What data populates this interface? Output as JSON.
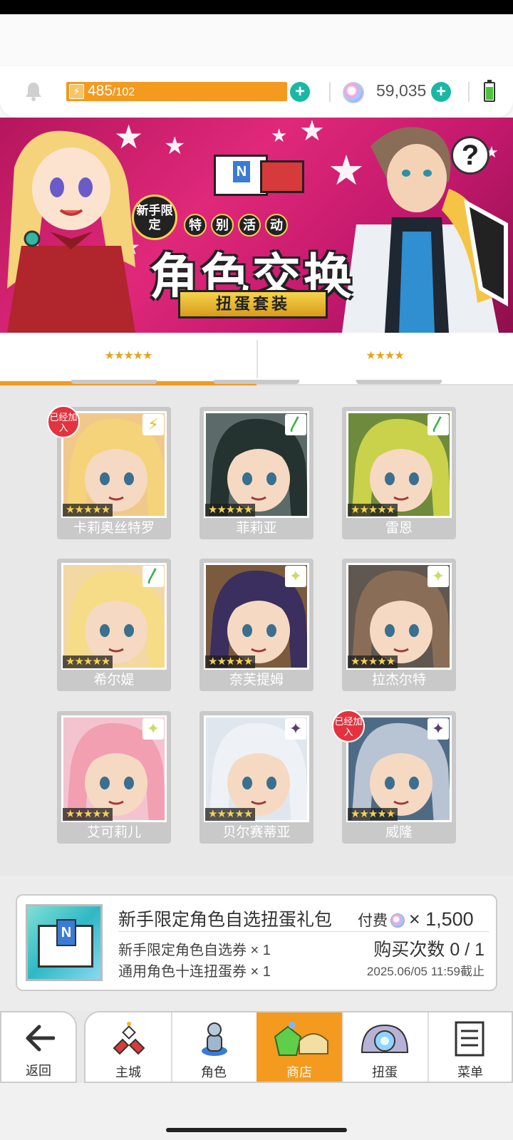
{
  "header": {
    "stamina": "485",
    "stamina_max": "/102",
    "gems": "59,035"
  },
  "banner": {
    "badge_new": "新手限定",
    "subtitle": [
      "特",
      "别",
      "活",
      "动"
    ],
    "title": "角色交换",
    "ribbon": "扭蛋套装",
    "help": "?"
  },
  "tabs": [
    {
      "label": "★★★★★",
      "active": true
    },
    {
      "label": "★★★★",
      "active": false
    }
  ],
  "characters": [
    {
      "name": "卡莉奥丝特罗",
      "element": "lightning",
      "element_glyph": "⚡",
      "element_color": "#f2b81f",
      "joined": true,
      "bg": "#f0c98a",
      "hair": "#f4d37a"
    },
    {
      "name": "菲莉亚",
      "element": "wind",
      "element_glyph": "〳",
      "element_color": "#3bb34a",
      "joined": false,
      "bg": "#5c6b6a",
      "hair": "#24332f"
    },
    {
      "name": "雷恩",
      "element": "wind",
      "element_glyph": "〳",
      "element_color": "#3bb34a",
      "joined": false,
      "bg": "#6e8a3c",
      "hair": "#c9d24a"
    },
    {
      "name": "希尔媞",
      "element": "wind",
      "element_glyph": "〳",
      "element_color": "#3bb34a",
      "joined": false,
      "bg": "#f3d8a4",
      "hair": "#f6dc86"
    },
    {
      "name": "奈芙提姆",
      "element": "light",
      "element_glyph": "✦",
      "element_color": "#c8dc6a",
      "joined": false,
      "bg": "#7b5a3d",
      "hair": "#3a2f5e"
    },
    {
      "name": "拉杰尔特",
      "element": "light",
      "element_glyph": "✦",
      "element_color": "#c8dc6a",
      "joined": false,
      "bg": "#5f5750",
      "hair": "#8a6d57"
    },
    {
      "name": "艾可莉儿",
      "element": "light",
      "element_glyph": "✦",
      "element_color": "#c8dc6a",
      "joined": false,
      "bg": "#f3c4cf",
      "hair": "#f29fb2"
    },
    {
      "name": "贝尔赛蒂亚",
      "element": "dark",
      "element_glyph": "✦",
      "element_color": "#5a3e6a",
      "joined": false,
      "bg": "#dfe6ee",
      "hair": "#eef2f6"
    },
    {
      "name": "威隆",
      "element": "dark",
      "element_glyph": "✦",
      "element_color": "#5a3e6a",
      "joined": true,
      "bg": "#4e6b86",
      "hair": "#b8c3d4"
    }
  ],
  "card_stars": "★★★★★",
  "joined_label": "已经加入",
  "offer": {
    "title": "新手限定角色自选扭蛋礼包",
    "pay_label": "付费",
    "price": "× 1,500",
    "item1": "新手限定角色自选券 × 1",
    "item2": "通用角色十连扭蛋券 × 1",
    "count": "购买次数 0 / 1",
    "deadline": "2025.06/05 11:59截止"
  },
  "nav": {
    "back": "返回",
    "items": [
      {
        "label": "主城",
        "icon": "castle-icon",
        "active": false
      },
      {
        "label": "角色",
        "icon": "character-icon",
        "active": false
      },
      {
        "label": "商店",
        "icon": "shop-icon",
        "active": true
      },
      {
        "label": "扭蛋",
        "icon": "gacha-icon",
        "active": false
      },
      {
        "label": "菜单",
        "icon": "menu-icon",
        "active": false
      }
    ]
  },
  "colors": {
    "accent": "#f39a1f",
    "teal": "#19b8a4",
    "banner": "#d7206f"
  }
}
